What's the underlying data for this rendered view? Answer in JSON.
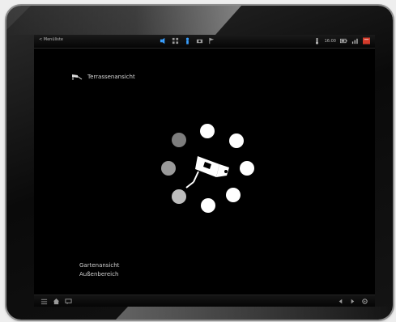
{
  "window": {
    "colors": {
      "bezel": "#111111",
      "screen": "#000000",
      "accent": "#3aa0ff",
      "alert": "#d23a2a"
    }
  },
  "statusbar": {
    "left_label": "< Menüliste",
    "right_label": "16:00",
    "center_icons": [
      "speaker-icon",
      "grid-icon",
      "blue-person-icon",
      "camera-icon",
      "flag-icon"
    ],
    "right_icons": [
      "temperature-icon",
      "battery-icon",
      "signal-icon",
      "alert-icon"
    ]
  },
  "room": {
    "title": "Terrassenansicht",
    "icon": "camera-flag-icon"
  },
  "camera_selector": {
    "positions": [
      {
        "name": "preset-1",
        "state": "active"
      },
      {
        "name": "preset-2",
        "state": "active"
      },
      {
        "name": "preset-3",
        "state": "active"
      },
      {
        "name": "preset-4",
        "state": "active"
      },
      {
        "name": "preset-5",
        "state": "active"
      },
      {
        "name": "preset-6",
        "state": "dimmed"
      },
      {
        "name": "preset-7",
        "state": "dimmed"
      },
      {
        "name": "preset-8",
        "state": "dimmed"
      }
    ]
  },
  "bottom_labels": {
    "line1": "Gartenansicht",
    "line2": "Außenbereich"
  },
  "bottombar": {
    "left_icons": [
      "menu-icon",
      "home-icon",
      "chat-icon"
    ],
    "right_icons": [
      "prev-icon",
      "next-icon",
      "settings-icon"
    ]
  }
}
